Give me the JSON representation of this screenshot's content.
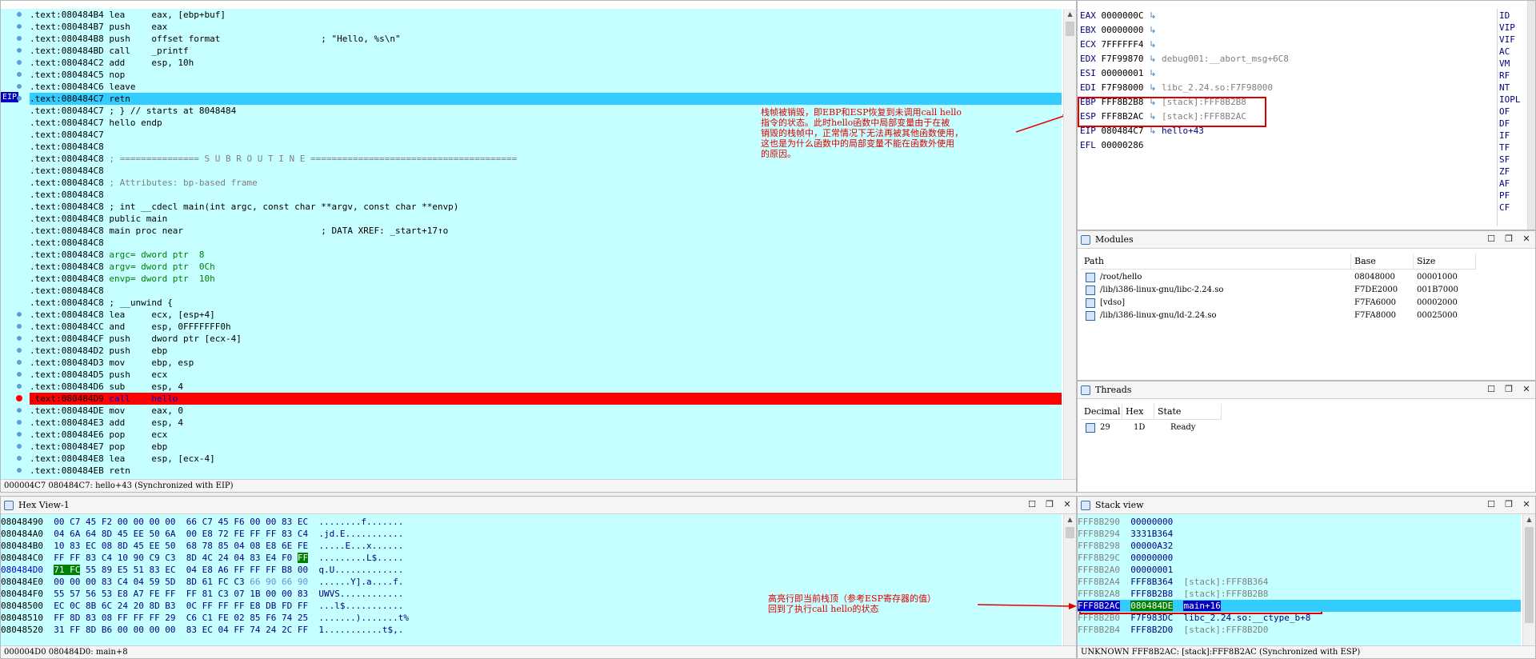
{
  "ida_view": {
    "title": "IDA View-EIP",
    "eip_label": "EIP",
    "lines": [
      {
        "addr": ".text:080484B4",
        "text": " lea     eax, [ebp+buf]",
        "kind": "code"
      },
      {
        "addr": ".text:080484B7",
        "text": " push    eax",
        "kind": "code"
      },
      {
        "addr": ".text:080484B8",
        "text": " push    offset format                   ; \"Hello, %s\\n\"",
        "kind": "code"
      },
      {
        "addr": ".text:080484BD",
        "text": " call    _printf",
        "kind": "code"
      },
      {
        "addr": ".text:080484C2",
        "text": " add     esp, 10h",
        "kind": "code"
      },
      {
        "addr": ".text:080484C5",
        "text": " nop",
        "kind": "code"
      },
      {
        "addr": ".text:080484C6",
        "text": " leave",
        "kind": "code"
      },
      {
        "addr": ".text:080484C7",
        "text": " retn",
        "kind": "current"
      },
      {
        "addr": ".text:080484C7",
        "text": " ; } // starts at 8048484",
        "kind": "code"
      },
      {
        "addr": ".text:080484C7",
        "text": " hello endp",
        "kind": "code"
      },
      {
        "addr": ".text:080484C7",
        "text": "",
        "kind": "code"
      },
      {
        "addr": ".text:080484C8",
        "text": "",
        "kind": "code"
      },
      {
        "addr": ".text:080484C8",
        "text": " ; =============== S U B R O U T I N E =======================================",
        "kind": "comment"
      },
      {
        "addr": ".text:080484C8",
        "text": "",
        "kind": "code"
      },
      {
        "addr": ".text:080484C8",
        "text": " ; Attributes: bp-based frame",
        "kind": "comment"
      },
      {
        "addr": ".text:080484C8",
        "text": "",
        "kind": "code"
      },
      {
        "addr": ".text:080484C8",
        "text": " ; int __cdecl main(int argc, const char **argv, const char **envp)",
        "kind": "code"
      },
      {
        "addr": ".text:080484C8",
        "text": " public main",
        "kind": "code"
      },
      {
        "addr": ".text:080484C8",
        "text": " main proc near                          ; DATA XREF: _start+17↑o",
        "kind": "xref"
      },
      {
        "addr": ".text:080484C8",
        "text": "",
        "kind": "code"
      },
      {
        "addr": ".text:080484C8",
        "text": " argc= dword ptr  8",
        "kind": "var"
      },
      {
        "addr": ".text:080484C8",
        "text": " argv= dword ptr  0Ch",
        "kind": "var"
      },
      {
        "addr": ".text:080484C8",
        "text": " envp= dword ptr  10h",
        "kind": "var"
      },
      {
        "addr": ".text:080484C8",
        "text": "",
        "kind": "code"
      },
      {
        "addr": ".text:080484C8",
        "text": " ; __unwind {",
        "kind": "code"
      },
      {
        "addr": ".text:080484C8",
        "text": " lea     ecx, [esp+4]",
        "kind": "code"
      },
      {
        "addr": ".text:080484CC",
        "text": " and     esp, 0FFFFFFF0h",
        "kind": "code"
      },
      {
        "addr": ".text:080484CF",
        "text": " push    dword ptr [ecx-4]",
        "kind": "code"
      },
      {
        "addr": ".text:080484D2",
        "text": " push    ebp",
        "kind": "code"
      },
      {
        "addr": ".text:080484D3",
        "text": " mov     ebp, esp",
        "kind": "code"
      },
      {
        "addr": ".text:080484D5",
        "text": " push    ecx",
        "kind": "code"
      },
      {
        "addr": ".text:080484D6",
        "text": " sub     esp, 4",
        "kind": "code"
      },
      {
        "addr": ".text:080484D9",
        "text": " call    hello",
        "kind": "breakpoint"
      },
      {
        "addr": ".text:080484DE",
        "text": " mov     eax, 0",
        "kind": "code"
      },
      {
        "addr": ".text:080484E3",
        "text": " add     esp, 4",
        "kind": "code"
      },
      {
        "addr": ".text:080484E6",
        "text": " pop     ecx",
        "kind": "code"
      },
      {
        "addr": ".text:080484E7",
        "text": " pop     ebp",
        "kind": "code"
      },
      {
        "addr": ".text:080484E8",
        "text": " lea     esp, [ecx-4]",
        "kind": "code"
      },
      {
        "addr": ".text:080484EB",
        "text": " retn",
        "kind": "code"
      }
    ],
    "status": "000004C7 080484C7: hello+43 (Synchronized with EIP)",
    "annotation": "栈帧被销毁，即EBP和ESP恢复到未调用call hello\n指令的状态。此时hello函数中局部变量由于在被\n销毁的栈帧中，正常情况下无法再被其他函数使用，\n这也是为什么函数中的局部变量不能在函数外使用\n的原因。"
  },
  "registers": {
    "title": "General registers",
    "rows": [
      {
        "name": "EAX",
        "value": "0000000C",
        "sym": ""
      },
      {
        "name": "EBX",
        "value": "00000000",
        "sym": ""
      },
      {
        "name": "ECX",
        "value": "7FFFFFF4",
        "sym": ""
      },
      {
        "name": "EDX",
        "value": "F7F99870",
        "sym": "debug001:__abort_msg+6C8"
      },
      {
        "name": "ESI",
        "value": "00000001",
        "sym": ""
      },
      {
        "name": "EDI",
        "value": "F7F98000",
        "sym": "libc_2.24.so:F7F98000"
      },
      {
        "name": "EBP",
        "value": "FFF8B2B8",
        "sym": "[stack]:FFF8B2B8"
      },
      {
        "name": "ESP",
        "value": "FFF8B2AC",
        "sym": "[stack]:FFF8B2AC"
      },
      {
        "name": "EIP",
        "value": "080484C7",
        "sym": "hello+43"
      },
      {
        "name": "EFL",
        "value": "00000286",
        "sym": ""
      }
    ],
    "flags": [
      {
        "name": "ID",
        "value": "0"
      },
      {
        "name": "VIP",
        "value": "0"
      },
      {
        "name": "VIF",
        "value": "0"
      },
      {
        "name": "AC",
        "value": "0"
      },
      {
        "name": "VM",
        "value": "0"
      },
      {
        "name": "RF",
        "value": "0"
      },
      {
        "name": "NT",
        "value": "0"
      },
      {
        "name": "IOPL",
        "value": "0"
      },
      {
        "name": "OF",
        "value": "0"
      },
      {
        "name": "DF",
        "value": "0"
      },
      {
        "name": "IF",
        "value": "1"
      },
      {
        "name": "TF",
        "value": "0"
      },
      {
        "name": "SF",
        "value": "1"
      },
      {
        "name": "ZF",
        "value": "0"
      },
      {
        "name": "AF",
        "value": "0"
      },
      {
        "name": "PF",
        "value": "1"
      },
      {
        "name": "CF",
        "value": "0"
      }
    ]
  },
  "modules": {
    "title": "Modules",
    "columns": [
      "Path",
      "Base",
      "Size"
    ],
    "rows": [
      {
        "path": "/root/hello",
        "base": "08048000",
        "size": "00001000"
      },
      {
        "path": "/lib/i386-linux-gnu/libc-2.24.so",
        "base": "F7DE2000",
        "size": "001B7000"
      },
      {
        "path": "[vdso]",
        "base": "F7FA6000",
        "size": "00002000"
      },
      {
        "path": "/lib/i386-linux-gnu/ld-2.24.so",
        "base": "F7FA8000",
        "size": "00025000"
      }
    ]
  },
  "threads": {
    "title": "Threads",
    "columns": [
      "Decimal",
      "Hex",
      "State"
    ],
    "rows": [
      {
        "decimal": "29",
        "hex": "1D",
        "state": "Ready"
      }
    ]
  },
  "hex_view": {
    "title": "Hex View-1",
    "rows": [
      {
        "addr": "08048490",
        "bytes": "00 C7 45 F2 00 00 00 00  66 C7 45 F6 00 00 83 EC",
        "ascii": "........f......."
      },
      {
        "addr": "080484A0",
        "bytes": "04 6A 64 8D 45 EE 50 6A  00 E8 72 FE FF FF 83 C4",
        "ascii": ".jd.E..........."
      },
      {
        "addr": "080484B0",
        "bytes": "10 83 EC 08 8D 45 EE 50  68 78 85 04 08 E8 6E FE",
        "ascii": ".....E...x......"
      },
      {
        "addr": "080484C0",
        "bytes": "FF FF 83 C4 10 90 C9 C3  8D 4C 24 04 83 E4 F0 ",
        "sel_end": "FF",
        "ascii": ".........L$....."
      },
      {
        "addr": "080484D0",
        "sel_start": "71 FC",
        "bytes": " 55 89 E5 51 83 EC  04 E8 A6 FF FF FF B8 00",
        "ascii": "q.U.............",
        "current": true
      },
      {
        "addr": "080484E0",
        "bytes": "00 00 00 83 C4 04 59 5D  8D 61 FC C3 ",
        "bytes_blue": "66 90 66 90",
        "ascii": "......Y].a....f."
      },
      {
        "addr": "080484F0",
        "bytes": "55 57 56 53 E8 A7 FE FF  FF 81 C3 07 1B 00 00 83",
        "ascii": "UWVS............"
      },
      {
        "addr": "08048500",
        "bytes": "EC 0C 8B 6C 24 20 8D B3  0C FF FF FF E8 DB FD FF",
        "ascii": "...l$..........."
      },
      {
        "addr": "08048510",
        "bytes": "FF 8D 83 08 FF FF FF 29  C6 C1 FE 02 85 F6 74 25",
        "ascii": ".......).......t%"
      },
      {
        "addr": "08048520",
        "bytes": "31 FF 8D B6 00 00 00 00  83 EC 04 FF 74 24 2C FF",
        "ascii": "1...........t$,."
      }
    ],
    "status": "000004D0 080484D0: main+8"
  },
  "stack_view": {
    "title": "Stack view",
    "rows": [
      {
        "addr": "FFF8B290",
        "value": "00000000",
        "sym": ""
      },
      {
        "addr": "FFF8B294",
        "value": "3331B364",
        "sym": ""
      },
      {
        "addr": "FFF8B298",
        "value": "00000A32",
        "sym": ""
      },
      {
        "addr": "FFF8B29C",
        "value": "00000000",
        "sym": ""
      },
      {
        "addr": "FFF8B2A0",
        "value": "00000001",
        "sym": ""
      },
      {
        "addr": "FFF8B2A4",
        "value": "FFF8B364",
        "sym": "[stack]:FFF8B364"
      },
      {
        "addr": "FFF8B2A8",
        "value": "FFF8B2B8",
        "sym": "[stack]:FFF8B2B8"
      },
      {
        "addr": "FFF8B2AC",
        "value": "080484DE",
        "sym": "main+16",
        "current": true
      },
      {
        "addr": "FFF8B2B0",
        "value": "F7F983DC",
        "sym": "libc_2.24.so:__ctype_b+8"
      },
      {
        "addr": "FFF8B2B4",
        "value": "FFF8B2D0",
        "sym": "[stack]:FFF8B2D0"
      }
    ],
    "status": "UNKNOWN FFF8B2AC: [stack]:FFF8B2AC (Synchronized with ESP)",
    "annotation": "高亮行即当前栈顶（参考ESP寄存器的值）\n回到了执行call hello的状态"
  },
  "colors": {
    "code_bg": "#c6ffff",
    "current_line": "#33ccff",
    "breakpoint": "#ff0000",
    "annotation_red": "#e00000"
  }
}
